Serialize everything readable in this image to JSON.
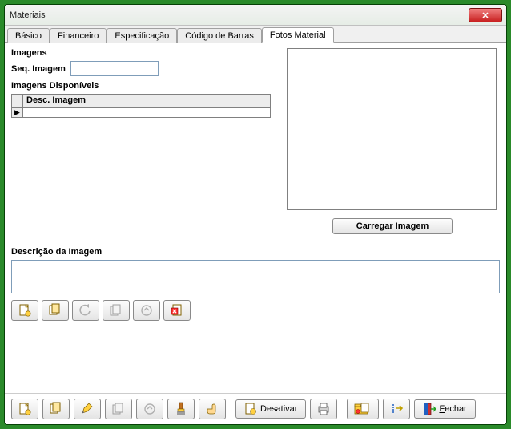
{
  "window": {
    "title": "Materiais"
  },
  "tabs": [
    {
      "label": "Básico"
    },
    {
      "label": "Financeiro"
    },
    {
      "label": "Especificação"
    },
    {
      "label": "Código de Barras"
    },
    {
      "label": "Fotos Material",
      "active": true
    }
  ],
  "panel": {
    "group_title": "Imagens",
    "seq_label": "Seq. Imagem",
    "seq_value": "",
    "avail_label": "Imagens Disponíveis",
    "grid_header": "Desc. Imagem",
    "load_button": "Carregar Imagem",
    "desc_label": "Descrição da Imagem",
    "desc_value": ""
  },
  "bottom": {
    "desativar": "Desativar",
    "fechar": "Fechar"
  }
}
